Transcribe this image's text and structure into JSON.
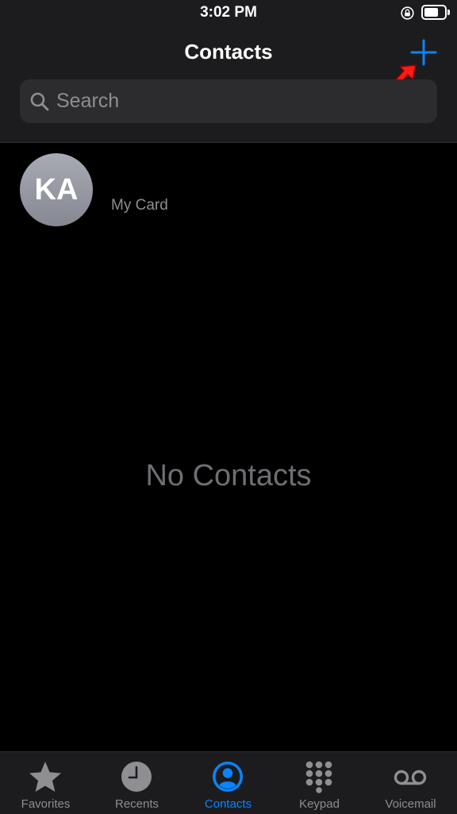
{
  "status_bar": {
    "time": "3:02 PM",
    "icons": [
      "orientation-lock-icon",
      "battery-icon"
    ],
    "battery_level": 0.75
  },
  "nav": {
    "title": "Contacts",
    "add_icon": "plus-icon"
  },
  "search": {
    "placeholder": "Search",
    "icon": "search-icon"
  },
  "my_card": {
    "initials": "KA",
    "label": "My Card"
  },
  "empty_state": {
    "label": "No Contacts"
  },
  "tab_bar": {
    "active": "Contacts",
    "tabs": [
      {
        "label": "Favorites",
        "icon": "star-icon"
      },
      {
        "label": "Recents",
        "icon": "clock-icon"
      },
      {
        "label": "Contacts",
        "icon": "person-circle-icon"
      },
      {
        "label": "Keypad",
        "icon": "keypad-icon"
      },
      {
        "label": "Voicemail",
        "icon": "voicemail-icon"
      }
    ]
  },
  "colors": {
    "accent": "#0a84ff",
    "annotation": "#ff1a1a",
    "inactive": "#8e8e93",
    "header_bg": "#1c1c1e"
  }
}
